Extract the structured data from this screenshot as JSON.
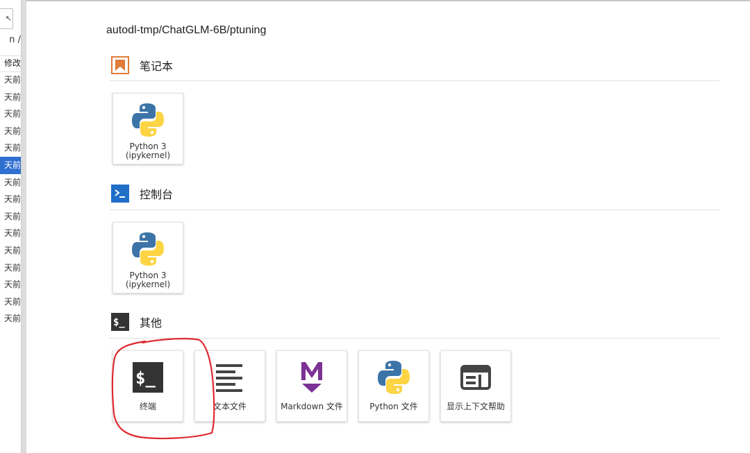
{
  "file_browser": {
    "top_button": "↖",
    "path": "n /",
    "header": "修改",
    "rows": [
      "天前",
      "天前",
      "天前",
      "天前",
      "天前",
      "天前",
      "天前",
      "天前",
      "天前",
      "天前",
      "天前",
      "天前",
      "天前",
      "天前",
      "天前"
    ],
    "selected_index": 5
  },
  "launcher": {
    "cwd": "autodl-tmp/ChatGLM-6B/ptuning",
    "sections": [
      {
        "title": "笔记本",
        "icon": "notebook-icon",
        "cards": [
          {
            "label": "Python 3\n(ipykernel)",
            "icon": "python-logo-icon"
          }
        ]
      },
      {
        "title": "控制台",
        "icon": "console-icon",
        "cards": [
          {
            "label": "Python 3\n(ipykernel)",
            "icon": "python-logo-icon"
          }
        ]
      },
      {
        "title": "其他",
        "icon": "terminal-icon",
        "cards": [
          {
            "label": "终端",
            "icon": "terminal-icon"
          },
          {
            "label": "文本文件",
            "icon": "text-file-icon"
          },
          {
            "label": "Markdown 文件",
            "icon": "markdown-icon"
          },
          {
            "label": "Python 文件",
            "icon": "python-logo-icon"
          },
          {
            "label": "显示上下文帮助",
            "icon": "context-help-icon"
          }
        ]
      }
    ]
  },
  "colors": {
    "notebook_accent": "#e07b39",
    "console_accent": "#1f6fc7",
    "terminal_dark": "#333333",
    "markdown_purple": "#7b3294",
    "selection_blue": "#2f6fd0",
    "annotation_red": "#e0282e"
  }
}
